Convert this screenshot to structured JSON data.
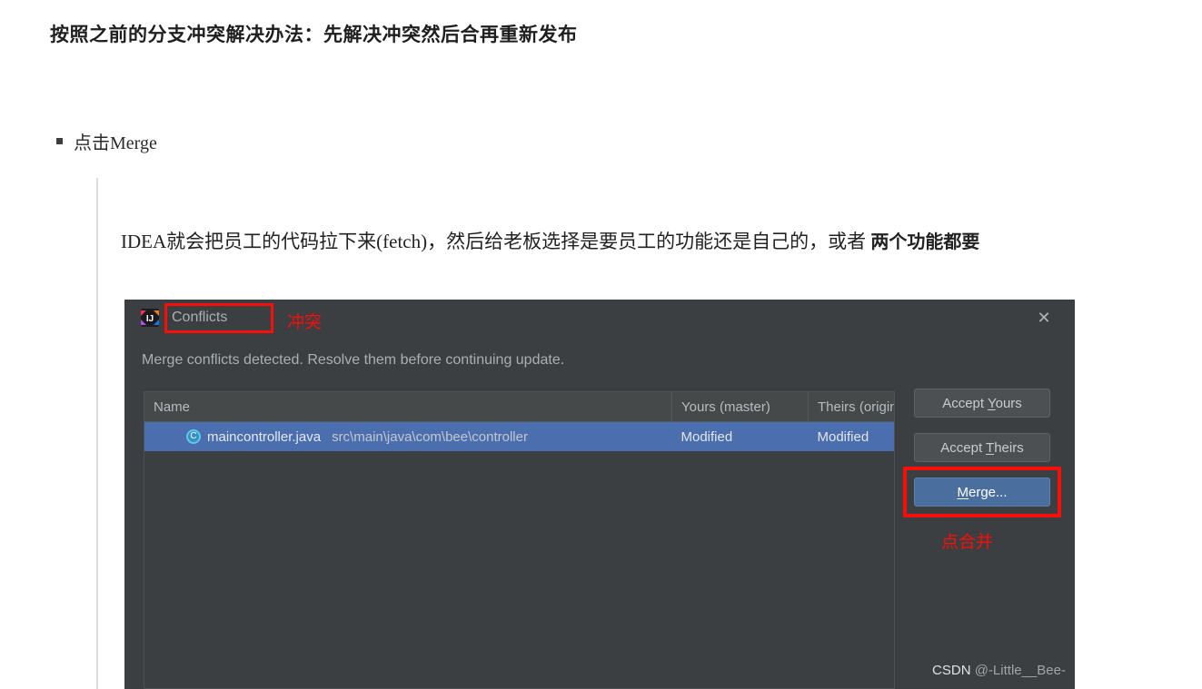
{
  "article": {
    "heading": "按照之前的分支冲突解决办法：先解决冲突然后合再重新发布",
    "bullet": {
      "marker": "square-bullet",
      "label": "点击Merge"
    },
    "quote": {
      "line_lead": "IDEA就会把员工的代码拉下来(fetch)，然后给老板选择是要员工的功能还是自己的，或者 ",
      "line_emph": "两个功能都要"
    }
  },
  "dialog": {
    "app_icon": "intellij-idea-icon",
    "title": "Conflicts",
    "title_annotation": "冲突",
    "close_icon": "✕",
    "message": "Merge conflicts detected. Resolve them before continuing update.",
    "table": {
      "columns": [
        "Name",
        "Yours (master)",
        "Theirs (origin/..."
      ],
      "rows": [
        {
          "icon": "java-class-icon",
          "icon_glyph": "C",
          "name": "maincontroller.java",
          "path": "src\\main\\java\\com\\bee\\controller",
          "yours": "Modified",
          "theirs": "Modified",
          "selected": true
        }
      ]
    },
    "buttons": {
      "accept_yours": {
        "pre": "Accept ",
        "mnemonic": "Y",
        "post": "ours"
      },
      "accept_theirs": {
        "pre": "Accept ",
        "mnemonic": "T",
        "post": "heirs"
      },
      "merge": {
        "pre": "",
        "mnemonic": "M",
        "post": "erge..."
      }
    },
    "merge_annotation": "点合并"
  },
  "watermark": {
    "brand": "CSDN",
    "handle": " @-Little__Bee-"
  },
  "colors": {
    "dialog_bg": "#3c3f41",
    "selection_blue": "#4b6eaf",
    "primary_button": "#4a6f9e",
    "annotation_red": "#fb0d08",
    "page_bg": "#ffffff"
  }
}
